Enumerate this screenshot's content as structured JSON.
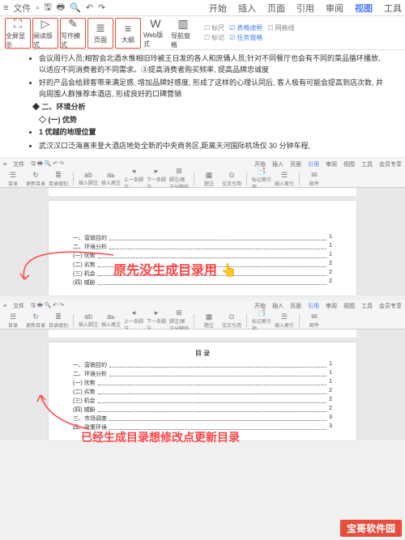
{
  "topbar": {
    "menu_label": "文件",
    "tabs": [
      "开始",
      "插入",
      "页面",
      "引用",
      "审阅",
      "视图",
      "工具"
    ],
    "active_tab": "视图"
  },
  "ribbon": {
    "btns": [
      {
        "icon": "⛶",
        "label": "全屏显示"
      },
      {
        "icon": "▷",
        "label": "阅读版式"
      },
      {
        "icon": "✎",
        "label": "写作模式"
      },
      {
        "icon": "≣",
        "label": "页面"
      },
      {
        "icon": "≡",
        "label": "大纲"
      },
      {
        "icon": "W",
        "label": "Web版式"
      },
      {
        "icon": "▥",
        "label": "导航窗格"
      }
    ],
    "checks": {
      "row1": [
        {
          "label": "标尺",
          "on": false
        },
        {
          "label": "表格虚框",
          "on": true
        },
        {
          "label": "网格线",
          "on": false
        }
      ],
      "row2": [
        {
          "label": "标记",
          "on": false
        },
        {
          "label": "任务窗格",
          "on": true
        }
      ]
    }
  },
  "doc": {
    "p1": "会议周行人员;相智会北酒水惟相旧玲被王日发的各人和庶俑人员;针对不同餐厅也会有不同的菜品循环播放, 以适应不同消费者的不同需求。③提高消费者购买频率, 提高品牌忠诚度",
    "p2": "好的产品会给顾客带来满足感, 增加品牌好感度, 形成了这样的心理认同后, 客人极有可能会提高到店次数, 并向周围人群推荐本酒店, 形成良好的口碑营销",
    "h1": "二、环境分析",
    "h2": "(一) 优势",
    "h3": "1  优越的地理位置",
    "p3": "武汉汉口泛海喜来登大酒店地处全新的中央商务区,距离天河国际机场仅 30 分钟车程,"
  },
  "sub_topbar": {
    "menu": "文件",
    "tabs": [
      "开始",
      "插入",
      "页面",
      "引用",
      "审阅",
      "视图",
      "工具",
      "会员专享"
    ],
    "active": "引用"
  },
  "sub_ribbon": {
    "btns": [
      {
        "ic": "☰",
        "lb": "目录"
      },
      {
        "ic": "↻",
        "lb": "更新目录"
      },
      {
        "ic": "≣",
        "lb": "目录级别"
      },
      {
        "ic": "ab",
        "lb": "插入脚注"
      },
      {
        "ic": "aь",
        "lb": "插入尾注"
      },
      {
        "ic": "◂",
        "lb": "上一条脚注"
      },
      {
        "ic": "▸",
        "lb": "下一条脚注"
      },
      {
        "ic": "⊞",
        "lb": "脚注/尾注分隔线"
      },
      {
        "ic": "▦",
        "lb": "题注"
      },
      {
        "ic": "⊙",
        "lb": "交叉引用"
      },
      {
        "ic": "📑",
        "lb": "标记索引项"
      },
      {
        "ic": "☰",
        "lb": "插入索引"
      },
      {
        "ic": "✉",
        "lb": "邮件"
      }
    ]
  },
  "annotation1": "原先没生成目录用 👆",
  "annotation2": "已经生成目录想修改点更新目录",
  "toc1": [
    {
      "t": "一、营销目的",
      "p": "1"
    },
    {
      "t": "二、环境分析",
      "p": "1"
    },
    {
      "t": "(一) 优势",
      "p": "1"
    },
    {
      "t": "(二) 劣势",
      "p": "2"
    },
    {
      "t": "(三) 机会",
      "p": "2"
    },
    {
      "t": "(四) 威胁",
      "p": "2"
    }
  ],
  "toc2": [
    {
      "t": "一、营销目的",
      "p": "1"
    },
    {
      "t": "二、环境分析",
      "p": "1"
    },
    {
      "t": "(一) 优势",
      "p": "1"
    },
    {
      "t": "(二) 劣势",
      "p": "2"
    },
    {
      "t": "(三) 机会",
      "p": "2"
    },
    {
      "t": "(四) 威胁",
      "p": "2"
    },
    {
      "t": "三、市场调查",
      "p": "3"
    },
    {
      "t": "四、政策环境",
      "p": "3"
    }
  ],
  "watermark": "宝哥软件园"
}
